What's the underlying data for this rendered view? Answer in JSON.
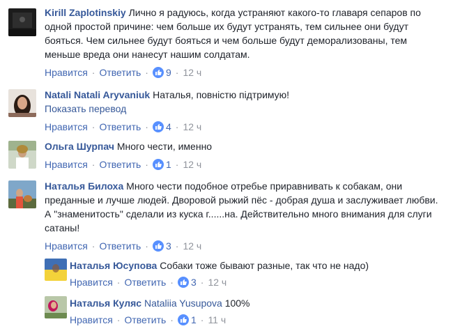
{
  "ui": {
    "like_label": "Нравится",
    "reply_label": "Ответить",
    "separator": "·"
  },
  "colors": {
    "link": "#365899",
    "action": "#4267b2",
    "meta": "#90949c",
    "like_badge": "#5890ff"
  },
  "comments": [
    {
      "author": "Kirill Zaplotinskiy",
      "text": "Лично я радуюсь, когда устраняют какого-то главаря сепаров по одной простой причине: чем больше их будут устранять, тем сильнее они будут бояться. Чем сильнее будут бояться и чем больше будут деморализованы, тем меньше вреда они нанесут нашим солдатам.",
      "likes": "9",
      "time": "12 ч",
      "like_icon": "thumbs-up-icon"
    },
    {
      "author": "Natali Natali Aryvaniuk",
      "text": "Наталья, повністю підтримую!",
      "translate_link": "Показать перевод",
      "likes": "4",
      "time": "12 ч",
      "like_icon": "thumbs-up-icon"
    },
    {
      "author": "Ольга Шурпач",
      "text": "Много чести, именно",
      "likes": "1",
      "time": "12 ч",
      "like_icon": "thumbs-up-icon"
    },
    {
      "author": "Наталья Билоха",
      "text": "Много чести подобное отребье приравнивать к собакам, они преданные и лучше людей. Дворовой рыжий пёс - добрая душа и заслуживает любви. А \"знаменитость\" сделали из куска г......на. Действительно много внимания для слуги сатаны!",
      "likes": "3",
      "time": "12 ч",
      "like_icon": "thumbs-up-icon"
    }
  ],
  "replies": [
    {
      "author": "Наталья Юсупова",
      "text": "Собаки тоже бывают разные, так что не надо)",
      "likes": "3",
      "time": "12 ч",
      "like_icon": "thumbs-up-icon"
    },
    {
      "author": "Наталья Куляс",
      "mention": "Nataliia Yusupova",
      "text": "100%",
      "likes": "1",
      "time": "11 ч",
      "like_icon": "thumbs-up-icon"
    }
  ]
}
